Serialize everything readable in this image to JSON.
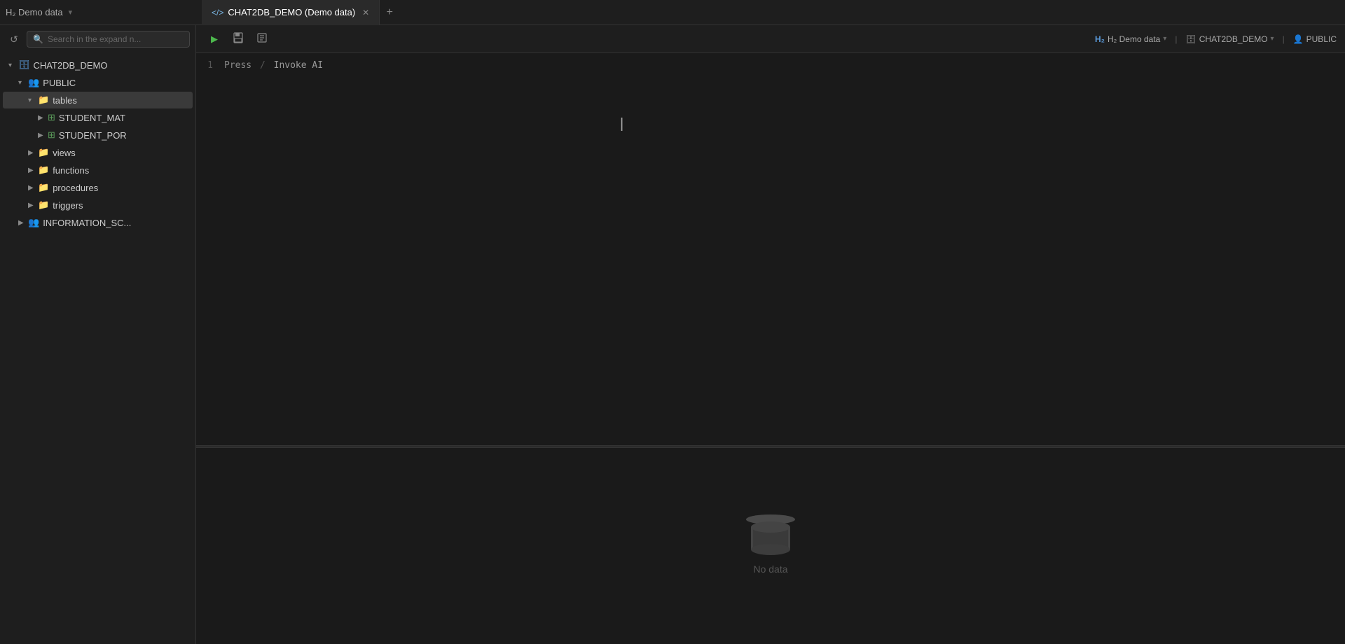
{
  "titleBar": {
    "appTitle": "H₂ Demo data",
    "chevron": "▾",
    "tabs": [
      {
        "id": "tab-1",
        "icon": "</>",
        "label": "CHAT2DB_DEMO (Demo data)",
        "active": true,
        "closable": true
      }
    ],
    "addTabLabel": "+"
  },
  "toolbar": {
    "runBtn": "▶",
    "saveBtn": "💾",
    "formatBtn": "⊞",
    "rightSection": {
      "dbLabel": "H₂ Demo data",
      "schemaLabel": "CHAT2DB_DEMO",
      "userLabel": "PUBLIC",
      "chevron": "▾"
    }
  },
  "sidebar": {
    "refreshIcon": "↺",
    "searchPlaceholder": "Search in the expand n...",
    "tree": {
      "root": {
        "label": "CHAT2DB_DEMO",
        "expanded": true,
        "children": [
          {
            "label": "PUBLIC",
            "expanded": true,
            "type": "schema",
            "children": [
              {
                "label": "tables",
                "expanded": true,
                "type": "folder",
                "selected": true,
                "children": [
                  {
                    "label": "STUDENT_MAT",
                    "type": "table",
                    "expanded": false
                  },
                  {
                    "label": "STUDENT_POR",
                    "type": "table",
                    "expanded": false
                  }
                ]
              },
              {
                "label": "views",
                "type": "folder",
                "expanded": false
              },
              {
                "label": "functions",
                "type": "folder",
                "expanded": false
              },
              {
                "label": "procedures",
                "type": "folder",
                "expanded": false
              },
              {
                "label": "triggers",
                "type": "folder",
                "expanded": false
              }
            ]
          },
          {
            "label": "INFORMATION_SC...",
            "type": "schema",
            "expanded": false
          }
        ]
      }
    }
  },
  "editor": {
    "lines": [
      {
        "number": "1",
        "press": "Press",
        "slash": "/",
        "invokeAI": "Invoke AI"
      }
    ]
  },
  "results": {
    "noDataText": "No data"
  }
}
